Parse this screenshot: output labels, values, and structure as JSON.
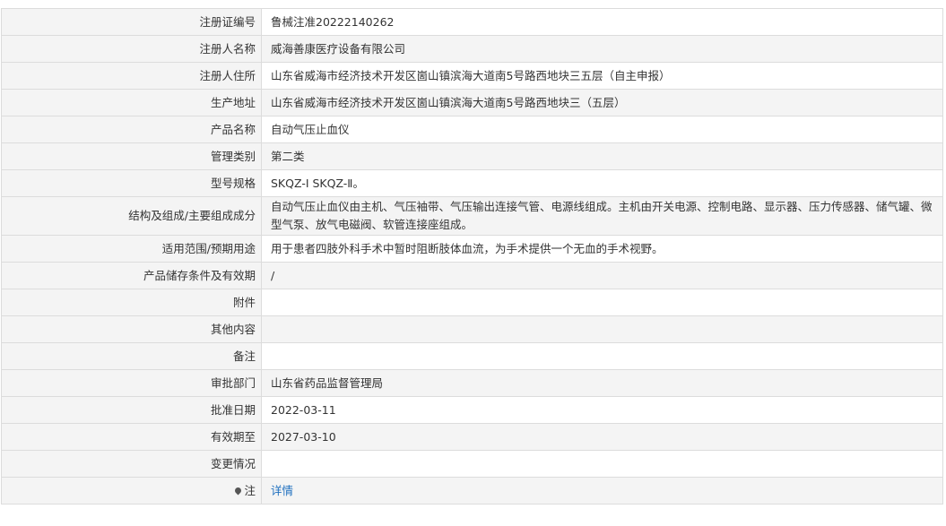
{
  "rows": [
    {
      "label": "注册证编号",
      "value": "鲁械注准20222140262"
    },
    {
      "label": "注册人名称",
      "value": "威海善康医疗设备有限公司"
    },
    {
      "label": "注册人住所",
      "value": "山东省威海市经济技术开发区崮山镇滨海大道南5号路西地块三五层（自主申报）"
    },
    {
      "label": "生产地址",
      "value": "山东省威海市经济技术开发区崮山镇滨海大道南5号路西地块三（五层）"
    },
    {
      "label": "产品名称",
      "value": "自动气压止血仪"
    },
    {
      "label": "管理类别",
      "value": "第二类"
    },
    {
      "label": "型号规格",
      "value": "SKQZ-Ⅰ SKQZ-Ⅱ。"
    },
    {
      "label": "结构及组成/主要组成成分",
      "value": "自动气压止血仪由主机、气压袖带、气压输出连接气管、电源线组成。主机由开关电源、控制电路、显示器、压力传感器、储气罐、微型气泵、放气电磁阀、软管连接座组成。"
    },
    {
      "label": "适用范围/预期用途",
      "value": "用于患者四肢外科手术中暂时阻断肢体血流，为手术提供一个无血的手术视野。"
    },
    {
      "label": "产品储存条件及有效期",
      "value": "/"
    },
    {
      "label": "附件",
      "value": ""
    },
    {
      "label": "其他内容",
      "value": ""
    },
    {
      "label": "备注",
      "value": ""
    },
    {
      "label": "审批部门",
      "value": "山东省药品监督管理局"
    },
    {
      "label": "批准日期",
      "value": "2022-03-11"
    },
    {
      "label": "有效期至",
      "value": "2027-03-10"
    },
    {
      "label": "变更情况",
      "value": ""
    }
  ],
  "note": {
    "label": "注",
    "icon": "pin-icon",
    "link_text": "详情"
  }
}
